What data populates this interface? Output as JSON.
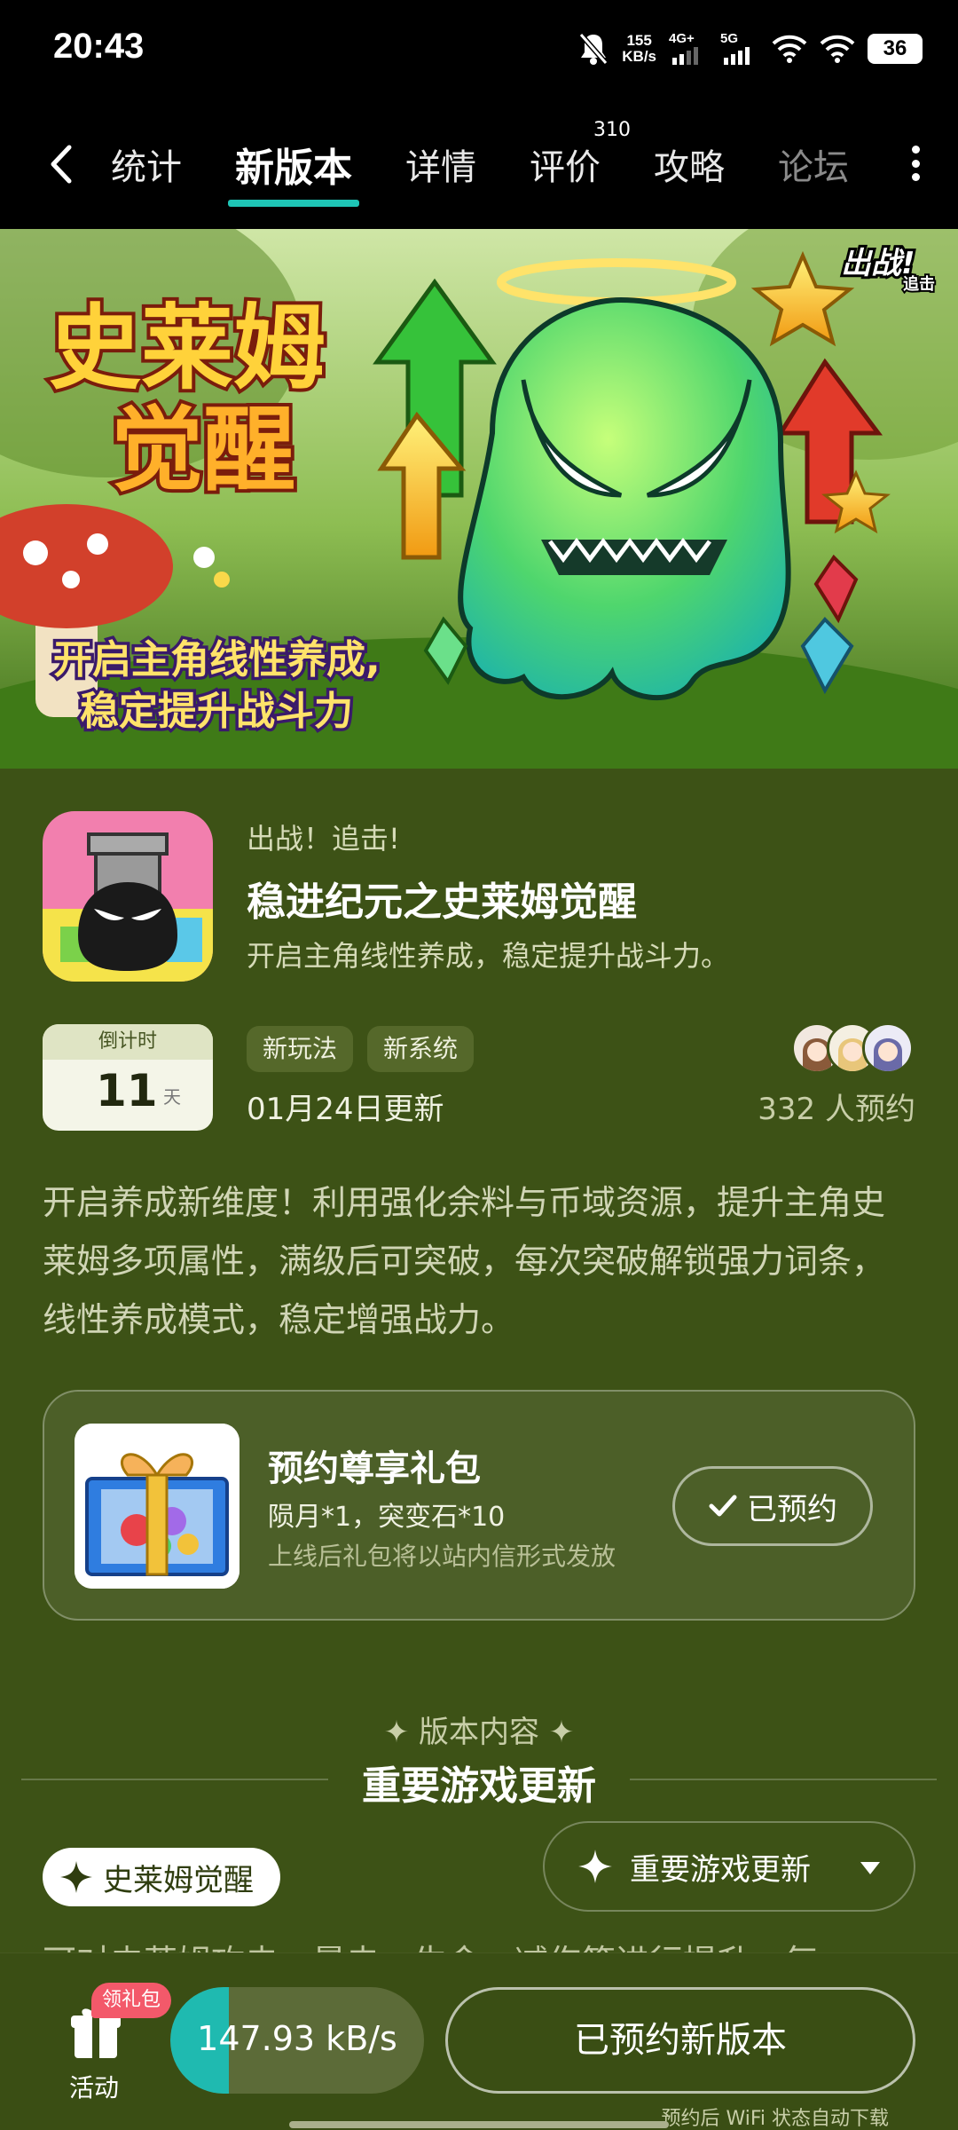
{
  "status_bar": {
    "time": "20:43",
    "net_speed_value": "155",
    "net_speed_unit": "KB/s",
    "signal_1_label": "4G+",
    "signal_2_label": "5G",
    "battery": "36",
    "icons": [
      "mute-bell-icon",
      "signal-icon",
      "wifi-icon",
      "battery-icon"
    ]
  },
  "nav": {
    "tabs": [
      {
        "label": "统计"
      },
      {
        "label": "新版本",
        "active": true
      },
      {
        "label": "详情"
      },
      {
        "label": "评价",
        "badge": "310"
      },
      {
        "label": "攻略"
      },
      {
        "label": "论坛"
      }
    ]
  },
  "banner": {
    "title_line1": "史莱姆",
    "title_line2": "觉醒",
    "slogan_line1": "开启主角线性养成,",
    "slogan_line2": "稳定提升战斗力",
    "logo_line1": "出战!",
    "logo_line2": "追击"
  },
  "game": {
    "kicker": "出战！追击!",
    "title": "稳进纪元之史莱姆觉醒",
    "subtitle": "开启主角线性养成，稳定提升战斗力。"
  },
  "countdown": {
    "label": "倒计时",
    "value": "11",
    "unit": "天"
  },
  "tags": [
    "新玩法",
    "新系统"
  ],
  "update_date": "01月24日更新",
  "reservations": "332 人预约",
  "description": "开启养成新维度！利用强化余料与币域资源，提升主角史莱姆多项属性，满级后可突破，每次突破解锁强力词条，线性养成模式，稳定增强战力。",
  "gift": {
    "title": "预约尊享礼包",
    "items": "陨月*1，突变石*10",
    "note": "上线后礼包将以站内信形式发放",
    "button": "已预约"
  },
  "version_section": {
    "kicker": "✦ 版本内容 ✦",
    "title": "重要游戏更新",
    "chip": "史莱姆觉醒",
    "dropdown_value": "重要游戏更新",
    "body_peek": "可对史莱姆攻击、暴击、生命、减伤等进行提升，每"
  },
  "bottom_bar": {
    "activity_label": "活动",
    "activity_badge": "领礼包",
    "download_speed": "147.93 kB/s",
    "download_progress": 0.23,
    "main_button": "已预约新版本",
    "wifi_note": "预约后 WiFi 状态自动下载"
  },
  "colors": {
    "page_bg": "#3d5216",
    "accent_teal": "#1ec5b6",
    "badge_pink": "#f3596a"
  }
}
